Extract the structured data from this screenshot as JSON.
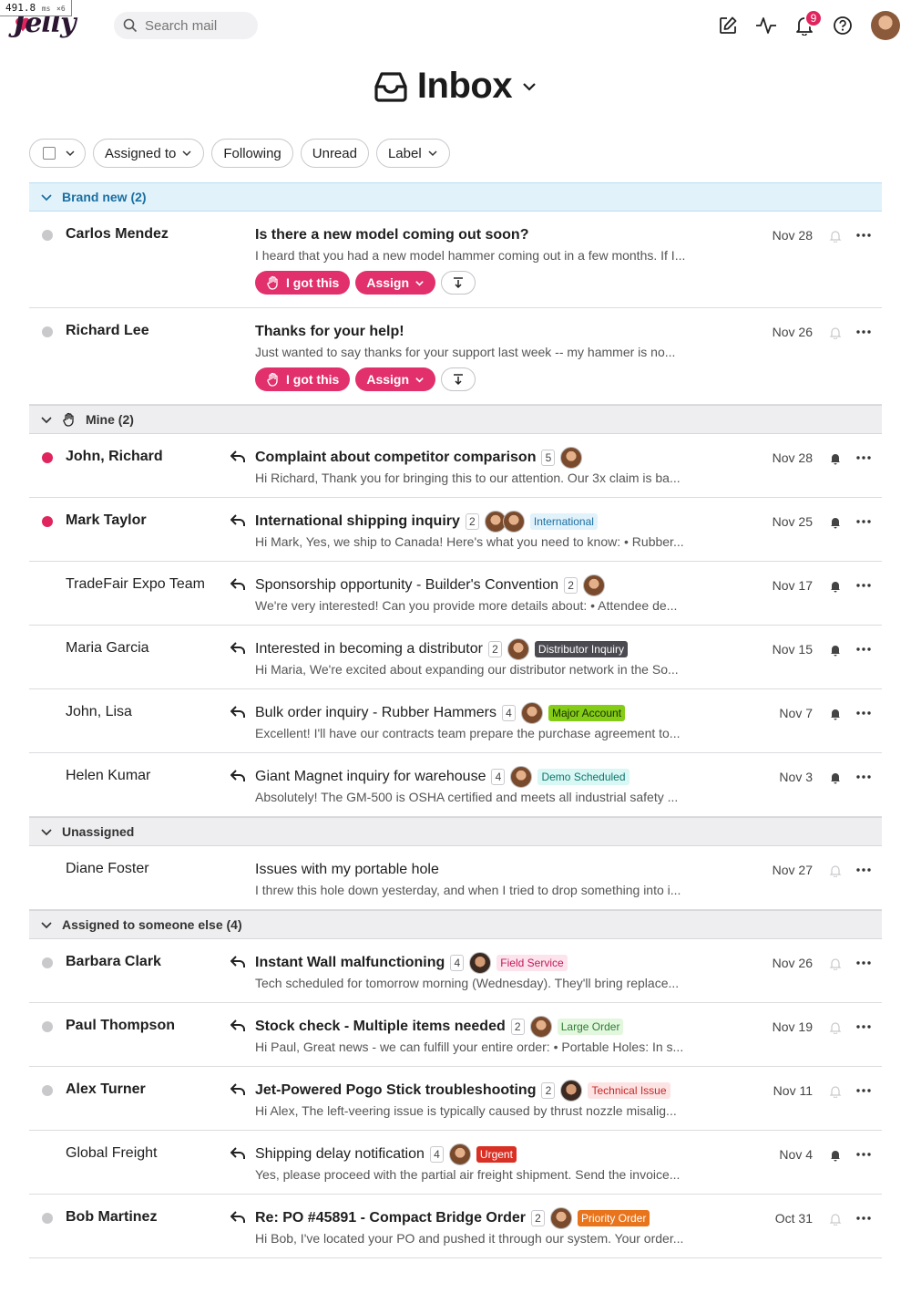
{
  "perf": {
    "value": "491.8",
    "unit": "ms",
    "mult": "×6"
  },
  "app": {
    "name": "Jelly"
  },
  "search": {
    "placeholder": "Search mail"
  },
  "header": {
    "notif_count": "9"
  },
  "page": {
    "title": "Inbox"
  },
  "filters": {
    "assigned": "Assigned to",
    "following": "Following",
    "unread": "Unread",
    "label": "Label"
  },
  "sections": {
    "brand_new": "Brand new (2)",
    "mine": "Mine (2)",
    "unassigned": "Unassigned",
    "someone_else": "Assigned to someone else (4)"
  },
  "buttons": {
    "i_got_this": "I got this",
    "assign": "Assign"
  },
  "brand_new": [
    {
      "sender": "Carlos Mendez",
      "subject": "Is there a new model coming out soon?",
      "preview": "I heard that you had a new model hammer coming out in a few months. If I...",
      "date": "Nov 28"
    },
    {
      "sender": "Richard Lee",
      "subject": "Thanks for your help!",
      "preview": "Just wanted to say thanks for your support last week -- my hammer is no...",
      "date": "Nov 26"
    }
  ],
  "mine": [
    {
      "sender": "John, Richard",
      "subject": "Complaint about competitor comparison",
      "count": "5",
      "preview": "Hi Richard, Thank you for bringing this to our attention. Our 3x claim is ba...",
      "date": "Nov 28"
    },
    {
      "sender": "Mark Taylor",
      "subject": "International shipping inquiry",
      "count": "2",
      "tag": "International",
      "preview": "Hi Mark, Yes, we ship to Canada! Here's what you need to know: • Rubber...",
      "date": "Nov 25"
    },
    {
      "sender": "TradeFair Expo Team",
      "subject": "Sponsorship opportunity - Builder's Convention",
      "count": "2",
      "preview": "We're very interested! Can you provide more details about: • Attendee de...",
      "date": "Nov 17"
    },
    {
      "sender": "Maria Garcia",
      "subject": "Interested in becoming a distributor",
      "count": "2",
      "tag": "Distributor Inquiry",
      "preview": "Hi Maria, We're excited about expanding our distributor network in the So...",
      "date": "Nov 15"
    },
    {
      "sender": "John, Lisa",
      "subject": "Bulk order inquiry - Rubber Hammers",
      "count": "4",
      "tag": "Major Account",
      "preview": "Excellent! I'll have our contracts team prepare the purchase agreement to...",
      "date": "Nov 7"
    },
    {
      "sender": "Helen Kumar",
      "subject": "Giant Magnet inquiry for warehouse",
      "count": "4",
      "tag": "Demo Scheduled",
      "preview": "Absolutely! The GM-500 is OSHA certified and meets all industrial safety ...",
      "date": "Nov 3"
    }
  ],
  "unassigned": [
    {
      "sender": "Diane Foster",
      "subject": "Issues with my portable hole",
      "preview": "I threw this hole down yesterday, and when I tried to drop something into i...",
      "date": "Nov 27"
    }
  ],
  "someone_else": [
    {
      "sender": "Barbara Clark",
      "subject": "Instant Wall malfunctioning",
      "count": "4",
      "tag": "Field Service",
      "preview": "Tech scheduled for tomorrow morning (Wednesday). They'll bring replace...",
      "date": "Nov 26"
    },
    {
      "sender": "Paul Thompson",
      "subject": "Stock check - Multiple items needed",
      "count": "2",
      "tag": "Large Order",
      "preview": "Hi Paul, Great news - we can fulfill your entire order: • Portable Holes: In s...",
      "date": "Nov 19"
    },
    {
      "sender": "Alex Turner",
      "subject": "Jet-Powered Pogo Stick troubleshooting",
      "count": "2",
      "tag": "Technical Issue",
      "preview": "Hi Alex, The left-veering issue is typically caused by thrust nozzle misalig...",
      "date": "Nov 11"
    },
    {
      "sender": "Global Freight",
      "subject": "Shipping delay notification",
      "count": "4",
      "tag": "Urgent",
      "preview": "Yes, please proceed with the partial air freight shipment. Send the invoice...",
      "date": "Nov 4"
    },
    {
      "sender": "Bob Martinez",
      "subject": "Re: PO #45891 - Compact Bridge Order",
      "count": "2",
      "tag": "Priority Order",
      "preview": "Hi Bob, I've located your PO and pushed it through our system. Your order...",
      "date": "Oct 31"
    }
  ],
  "colors": {
    "accent": "#e1306c",
    "unread_dot": "#e0245e",
    "brand_section_bg": "#e1f2fb",
    "brand_section_text": "#1a6fa1"
  }
}
